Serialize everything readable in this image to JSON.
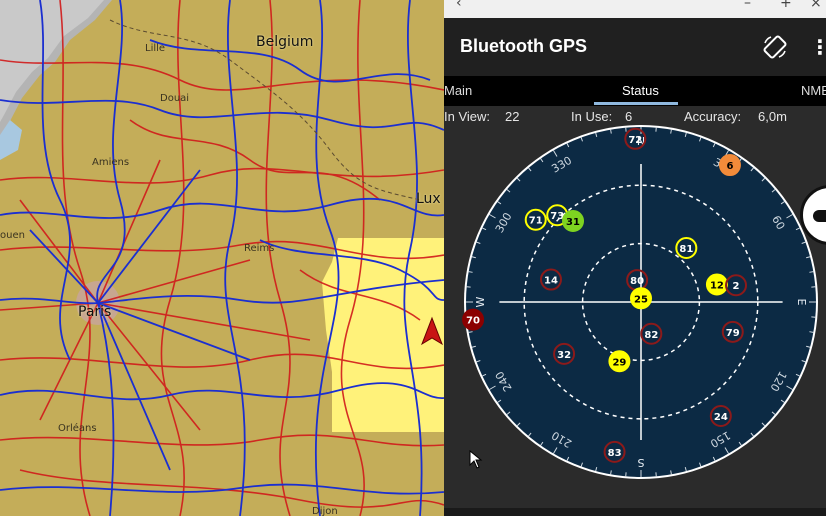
{
  "map": {
    "cities_big": [
      {
        "name": "Belgium",
        "id": "belgium"
      },
      {
        "name": "Paris",
        "id": "paris"
      },
      {
        "name": "Lux",
        "id": "lux"
      }
    ],
    "cities_small": [
      {
        "name": "Lille",
        "id": "lille"
      },
      {
        "name": "Douai",
        "id": "douai"
      },
      {
        "name": "Amiens",
        "id": "amiens"
      },
      {
        "name": "Reims",
        "id": "reims"
      },
      {
        "name": "ouen",
        "id": "rouen"
      },
      {
        "name": "Orléans",
        "id": "orleans"
      },
      {
        "name": "Dijon",
        "id": "dijon"
      }
    ]
  },
  "app": {
    "title": "Bluetooth GPS",
    "menu_icon": "more-vert-icon",
    "rotate_icon": "screen-rotation-icon"
  },
  "tabs": [
    {
      "label": "Main"
    },
    {
      "label": "Status"
    },
    {
      "label": "NME"
    }
  ],
  "stats": {
    "in_view_label": "In View:",
    "in_view_value": "22",
    "in_use_label": "In Use:",
    "in_use_value": "6",
    "accuracy_label": "Accuracy:",
    "accuracy_value": "6,0m"
  },
  "skyplot": {
    "cardinals": {
      "n": "N",
      "e": "E",
      "s": "S",
      "w": "W"
    },
    "bearing_labels": [
      "30",
      "60",
      "120",
      "150",
      "210",
      "240",
      "300",
      "330"
    ],
    "satellites": [
      {
        "id": "72",
        "az": 358,
        "el": 2,
        "style": "outline-red"
      },
      {
        "id": "6",
        "az": 33,
        "el": 2,
        "style": "orange"
      },
      {
        "id": "71",
        "az": 308,
        "el": 18,
        "style": "outline-yellow"
      },
      {
        "id": "73",
        "az": 316,
        "el": 25,
        "style": "outline-yellow"
      },
      {
        "id": "31",
        "az": 320,
        "el": 33,
        "style": "green"
      },
      {
        "id": "81",
        "az": 40,
        "el": 52,
        "style": "outline-yellow"
      },
      {
        "id": "80",
        "az": 350,
        "el": 78,
        "style": "outline-red"
      },
      {
        "id": "25",
        "az": 0,
        "el": 88,
        "style": "yellow"
      },
      {
        "id": "12",
        "az": 77,
        "el": 48,
        "style": "yellow"
      },
      {
        "id": "2",
        "az": 80,
        "el": 38,
        "style": "outline-red"
      },
      {
        "id": "14",
        "az": 284,
        "el": 40,
        "style": "outline-red"
      },
      {
        "id": "70",
        "az": 264,
        "el": -1,
        "style": "darkred"
      },
      {
        "id": "79",
        "az": 108,
        "el": 38,
        "style": "outline-red"
      },
      {
        "id": "32",
        "az": 236,
        "el": 40,
        "style": "outline-red"
      },
      {
        "id": "82",
        "az": 162,
        "el": 72,
        "style": "outline-red"
      },
      {
        "id": "29",
        "az": 200,
        "el": 56,
        "style": "yellow"
      },
      {
        "id": "24",
        "az": 145,
        "el": 15,
        "style": "outline-red"
      },
      {
        "id": "83",
        "az": 190,
        "el": 8,
        "style": "outline-red"
      }
    ],
    "colors": {
      "sky": "#0c2a44",
      "yellow": "#ffff00",
      "green": "#7ed321",
      "orange": "#f28b3a",
      "darkred": "#8b0000",
      "ring_red": "#8c1a1a"
    }
  }
}
